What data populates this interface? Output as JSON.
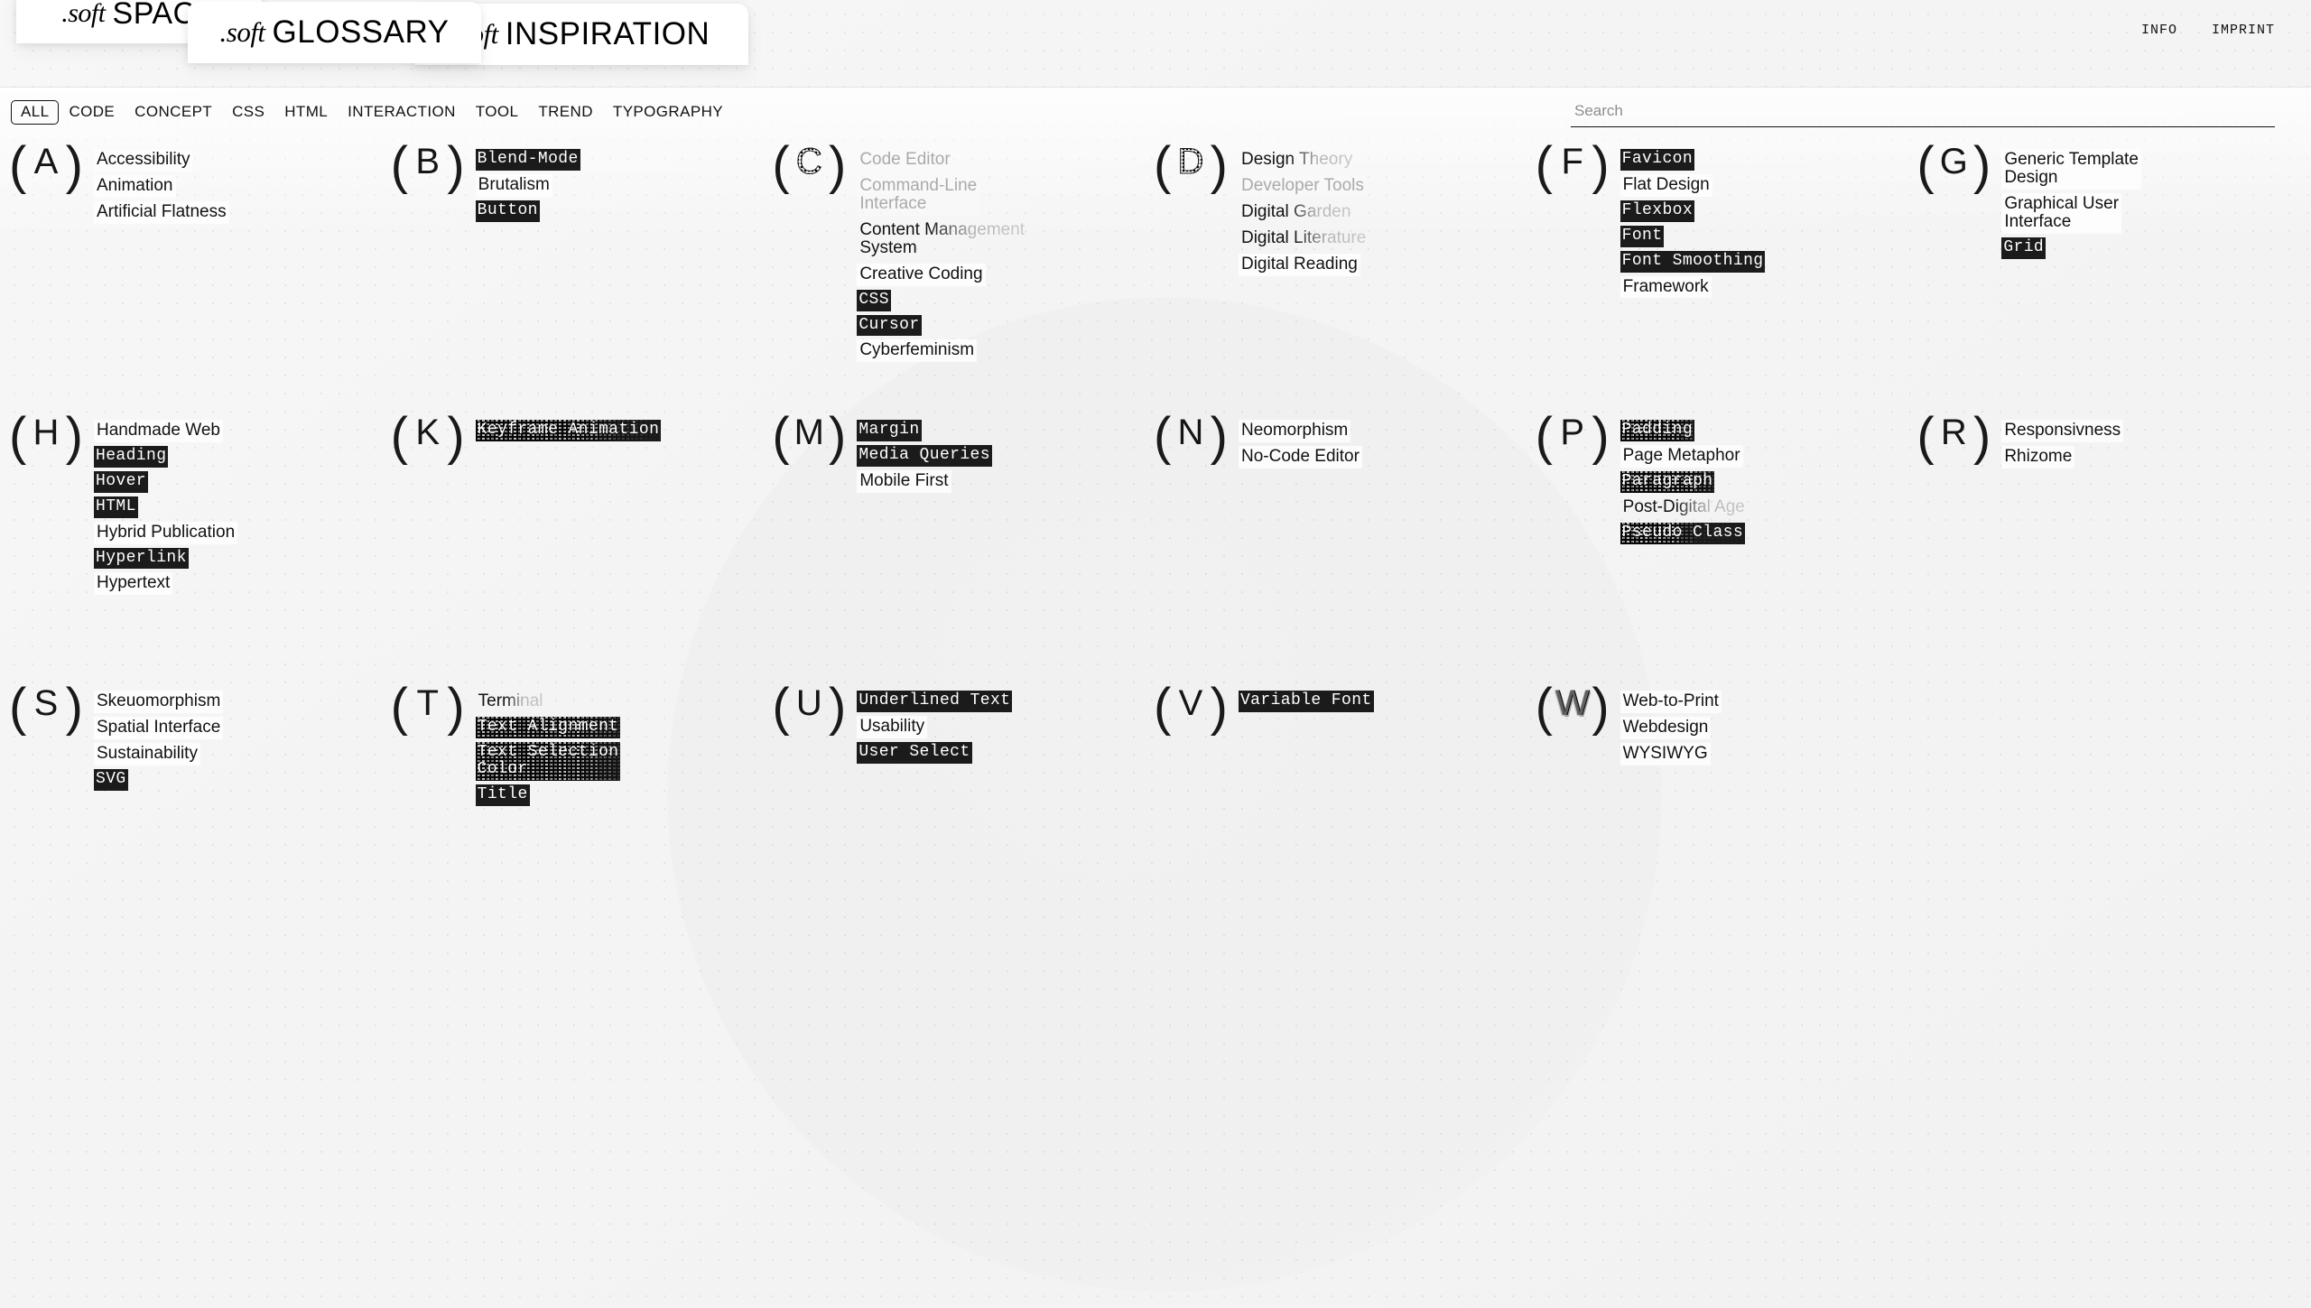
{
  "header": {
    "tabs": [
      {
        "id": "space",
        "soft": ".soft",
        "word": "SPACE"
      },
      {
        "id": "glossary",
        "soft": ".soft",
        "word": "GLOSSARY"
      },
      {
        "id": "inspiration",
        "soft": ".soft",
        "word": "INSPIRATION"
      }
    ],
    "links": [
      {
        "id": "info",
        "label": "INFO"
      },
      {
        "id": "imprint",
        "label": "IMPRINT"
      }
    ]
  },
  "filterbar": {
    "active": "ALL",
    "filters": [
      "ALL",
      "CODE",
      "CONCEPT",
      "CSS",
      "HTML",
      "INTERACTION",
      "TOOL",
      "TREND",
      "TYPOGRAPHY"
    ],
    "search": {
      "placeholder": "Search",
      "value": ""
    }
  },
  "glossary": {
    "groups": [
      {
        "letter": "A",
        "mark": "plain",
        "terms": [
          {
            "text": "Accessibility",
            "style": "plain"
          },
          {
            "text": "Animation",
            "style": "plain"
          },
          {
            "text": "Artificial Flatness",
            "style": "plain"
          }
        ]
      },
      {
        "letter": "B",
        "mark": "plain",
        "terms": [
          {
            "text": "Blend-Mode",
            "style": "inv"
          },
          {
            "text": "Brutalism",
            "style": "plain"
          },
          {
            "text": "Button",
            "style": "inv"
          }
        ]
      },
      {
        "letter": "C",
        "mark": "dotted",
        "terms": [
          {
            "text": "Code Editor",
            "style": "faded"
          },
          {
            "text": "Command-Line\nInterface",
            "style": "faded"
          },
          {
            "text": "Content Management\nSystem",
            "style": "half-fade"
          },
          {
            "text": "Creative Coding",
            "style": "plain"
          },
          {
            "text": "CSS",
            "style": "inv"
          },
          {
            "text": "Cursor",
            "style": "inv"
          },
          {
            "text": "Cyberfeminism",
            "style": "plain"
          }
        ]
      },
      {
        "letter": "D",
        "mark": "dotted",
        "terms": [
          {
            "text": "Design Theory",
            "style": "half-fade"
          },
          {
            "text": "Developer Tools",
            "style": "faded"
          },
          {
            "text": "Digital Garden",
            "style": "half-fade"
          },
          {
            "text": "Digital Literature",
            "style": "half-fade"
          },
          {
            "text": "Digital Reading",
            "style": "plain"
          }
        ]
      },
      {
        "letter": "F",
        "mark": "plain",
        "terms": [
          {
            "text": "Favicon",
            "style": "inv"
          },
          {
            "text": "Flat Design",
            "style": "plain"
          },
          {
            "text": "Flexbox",
            "style": "inv"
          },
          {
            "text": "Font",
            "style": "inv"
          },
          {
            "text": "Font Smoothing",
            "style": "inv"
          },
          {
            "text": "Framework",
            "style": "plain"
          }
        ]
      },
      {
        "letter": "G",
        "mark": "plain",
        "terms": [
          {
            "text": "Generic Template\nDesign",
            "style": "plain"
          },
          {
            "text": "Graphical User\nInterface",
            "style": "plain"
          },
          {
            "text": "Grid",
            "style": "inv"
          }
        ]
      },
      {
        "letter": "H",
        "mark": "plain",
        "terms": [
          {
            "text": "Handmade Web",
            "style": "plain"
          },
          {
            "text": "Heading",
            "style": "inv"
          },
          {
            "text": "Hover",
            "style": "inv"
          },
          {
            "text": "HTML",
            "style": "inv"
          },
          {
            "text": "Hybrid Publication",
            "style": "plain"
          },
          {
            "text": "Hyperlink",
            "style": "inv"
          },
          {
            "text": "Hypertext",
            "style": "plain"
          }
        ]
      },
      {
        "letter": "K",
        "mark": "plain",
        "terms": [
          {
            "text": "Keyframe Animation",
            "style": "noise"
          }
        ]
      },
      {
        "letter": "M",
        "mark": "plain",
        "terms": [
          {
            "text": "Margin",
            "style": "inv"
          },
          {
            "text": "Media Queries",
            "style": "inv"
          },
          {
            "text": "Mobile First",
            "style": "plain"
          }
        ]
      },
      {
        "letter": "N",
        "mark": "plain",
        "terms": [
          {
            "text": "Neomorphism",
            "style": "plain"
          },
          {
            "text": "No-Code Editor",
            "style": "plain"
          }
        ]
      },
      {
        "letter": "P",
        "mark": "plain",
        "terms": [
          {
            "text": "Padding",
            "style": "noise-full"
          },
          {
            "text": "Page Metaphor",
            "style": "plain"
          },
          {
            "text": "Paragraph",
            "style": "noise-full"
          },
          {
            "text": "Post-Digital Age",
            "style": "half-fade"
          },
          {
            "text": "Pseudo Class",
            "style": "noise-left"
          }
        ]
      },
      {
        "letter": "R",
        "mark": "plain",
        "terms": [
          {
            "text": "Responsivness",
            "style": "plain"
          },
          {
            "text": "Rhizome",
            "style": "plain"
          }
        ]
      },
      {
        "letter": "S",
        "mark": "plain",
        "terms": [
          {
            "text": "Skeuomorphism",
            "style": "plain"
          },
          {
            "text": "Spatial Interface",
            "style": "plain"
          },
          {
            "text": "Sustainability",
            "style": "plain"
          },
          {
            "text": "SVG",
            "style": "inv"
          }
        ]
      },
      {
        "letter": "T",
        "mark": "plain",
        "terms": [
          {
            "text": "Terminal",
            "style": "half-fade"
          },
          {
            "text": "Text Alignment",
            "style": "noise-full"
          },
          {
            "text": "Text Selection\nColor",
            "style": "noise-full"
          },
          {
            "text": "Title",
            "style": "inv"
          }
        ]
      },
      {
        "letter": "U",
        "mark": "plain",
        "terms": [
          {
            "text": "Underlined Text",
            "style": "inv"
          },
          {
            "text": "Usability",
            "style": "plain"
          },
          {
            "text": "User Select",
            "style": "inv"
          }
        ]
      },
      {
        "letter": "V",
        "mark": "plain",
        "terms": [
          {
            "text": "Variable Font",
            "style": "inv"
          }
        ]
      },
      {
        "letter": "W",
        "mark": "speckle",
        "terms": [
          {
            "text": "Web-to-Print",
            "style": "plain"
          },
          {
            "text": "Webdesign",
            "style": "plain"
          },
          {
            "text": "WYSIWYG",
            "style": "plain"
          }
        ]
      }
    ]
  },
  "colors": {
    "background": "#f4f4f4",
    "text": "#111111",
    "inverted_chip_bg": "#1b1b1b",
    "inverted_chip_text": "#ffffff",
    "faded_text": "#aaaaaa",
    "tab_bg": "#ffffff"
  }
}
